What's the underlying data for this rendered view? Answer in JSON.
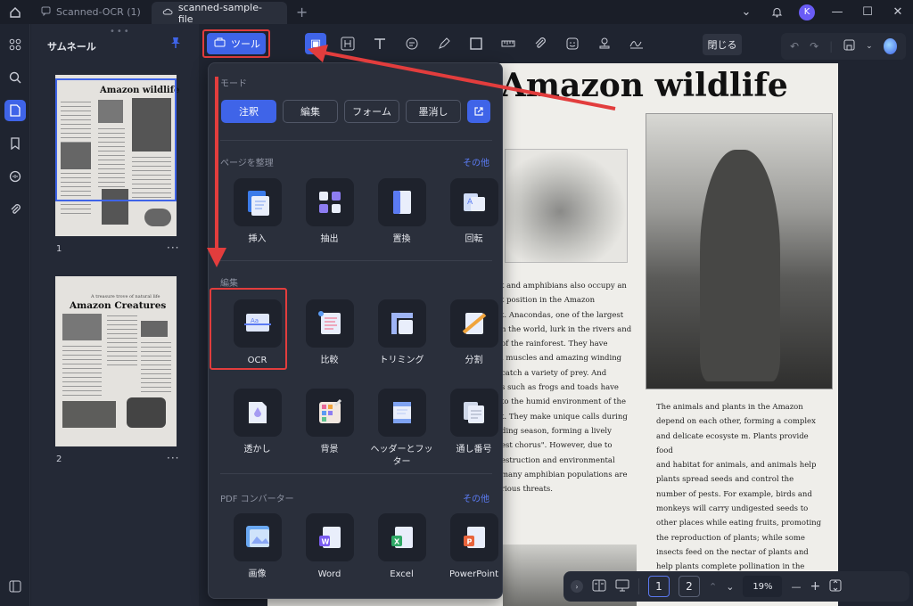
{
  "titlebar": {
    "tabs": [
      {
        "label": "Scanned-OCR (1)",
        "active": false
      },
      {
        "label": "scanned-sample-file",
        "active": true
      }
    ],
    "avatar_initial": "K"
  },
  "thumbnails": {
    "title": "サムネール",
    "pages": [
      {
        "number": "1",
        "heading": "Amazon wildlife"
      },
      {
        "number": "2",
        "heading": "Amazon Creatures",
        "subheading": "A treasure trove of natural life"
      }
    ]
  },
  "toolbar": {
    "tool_label": "ツール",
    "close_label": "閉じる"
  },
  "popup": {
    "mode_title": "モード",
    "modes": [
      "注釈",
      "編集",
      "フォーム",
      "墨消し"
    ],
    "organize_title": "ページを整理",
    "more_label": "その他",
    "organize_items": [
      {
        "label": "挿入",
        "icon": "insert-page-icon"
      },
      {
        "label": "抽出",
        "icon": "extract-icon"
      },
      {
        "label": "置換",
        "icon": "replace-icon"
      },
      {
        "label": "回転",
        "icon": "rotate-icon"
      }
    ],
    "edit_title": "編集",
    "edit_items": [
      {
        "label": "OCR",
        "icon": "ocr-icon"
      },
      {
        "label": "比較",
        "icon": "compare-icon"
      },
      {
        "label": "トリミング",
        "icon": "crop-icon"
      },
      {
        "label": "分割",
        "icon": "split-icon"
      },
      {
        "label": "透かし",
        "icon": "watermark-icon"
      },
      {
        "label": "背景",
        "icon": "background-icon"
      },
      {
        "label": "ヘッダーとフッター",
        "icon": "header-footer-icon"
      },
      {
        "label": "通し番号",
        "icon": "bates-number-icon"
      }
    ],
    "converter_title": "PDF コンバーター",
    "converter_items": [
      {
        "label": "画像",
        "icon": "image-icon"
      },
      {
        "label": "Word",
        "icon": "word-icon"
      },
      {
        "label": "Excel",
        "icon": "excel-icon"
      },
      {
        "label": "PowerPoint",
        "icon": "powerpoint-icon"
      }
    ]
  },
  "document": {
    "title": "Amazon wildlife",
    "left_column": "t and amphibians also occupy an\nt position in the Amazon\nt. Anacondas, one of the largest\nn the world, lurk in the rivers and\nof the rainforest. They have\nl muscles and amazing winding\ncatch a variety of prey. And\ns such as frogs and toads have\nto the humid environment of the\nt. They make unique calls during\nding season, forming a lively\nest chorus\". However, due to\nestruction and environmental\nmany amphibian populations are\nrious threats.",
    "right_column": "The animals and plants in the Amazon\ndepend on each other, forming a complex\nand delicate ecosyste m. Plants provide food\nand habitat for animals, and animals help\nplants spread seeds and control the\nnumber of pests. For example, birds and\nmonkeys will carry undigested seeds to\nother places while eating fruits, promoting\nthe reproduction of plants; while some\ninsects feed on the nectar of plants and\nhelp plants complete pollination in the\nprocess of collecting nectar."
  },
  "bottombar": {
    "pages": [
      "1",
      "2"
    ],
    "current_page": "1",
    "zoom": "19%"
  },
  "colors": {
    "accent": "#3f64e8",
    "highlight": "#e23d3d",
    "background": "#1f2430",
    "panel": "#2a2f3b"
  }
}
